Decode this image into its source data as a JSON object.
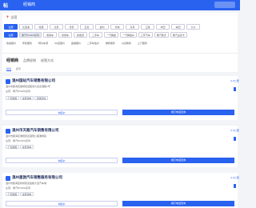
{
  "header": {
    "logo": "帖",
    "title": "经销商",
    "action": ""
  },
  "location": {
    "label": "全国"
  },
  "filters": {
    "row1": [
      "全部",
      "比亚迪",
      "哈弗",
      "北京",
      "长安",
      "五菱",
      "吉利",
      "长城",
      "东风",
      "江淮",
      "丰田",
      "本田",
      "大众",
      "三菱"
    ],
    "row2": [
      "全部",
      "重汽HOWO系列",
      "乘用车",
      "商用车",
      "新能源",
      "二手车",
      "一汽解放",
      "一汽解放J6",
      "三环汽车",
      "重汽豪沃",
      "重汽汕德卡"
    ],
    "row3": [
      "快速报价",
      "年检服务",
      "特价车源",
      "4S店报价",
      "金融报价",
      "二手车估价",
      "维修保养",
      "以旧换新",
      "上门服务"
    ]
  },
  "tabs": [
    {
      "label": "经销商",
      "active": true
    },
    {
      "label": "品牌经销",
      "active": false
    },
    {
      "label": "经营方式",
      "active": false
    }
  ],
  "subtabs": [
    {
      "label": "综合",
      "active": true
    },
    {
      "label": "距离",
      "active": false
    }
  ],
  "cards": [
    {
      "name": "温州国站汽车销售有限公司",
      "address": "温州市瓯海区娄桥街道瓯海大道龙港路1号",
      "brands_label": "主营：",
      "brands": "重汽HOWO系列",
      "tags": [
        "厂商授权",
        "在售新车",
        "店铺活动"
      ],
      "distance": "4.2公里",
      "left_button": "询底价",
      "right_button": "拨打电话咨询"
    },
    {
      "name": "温州市天路汽车销售有限公司",
      "address": "温州市瓯海区潘桥街道温瑞公路潘桥段",
      "brands_label": "主营：",
      "brands": "重汽HOWO系列",
      "tags": [
        "厂商授权",
        "在售新车"
      ],
      "distance": "4.2公里",
      "left_button": "询底价",
      "right_button": "拨打电话咨询"
    },
    {
      "name": "温州星驰汽车销售服务有限公司",
      "address": "温州市瓯海区新桥街道金蟾大道汽车城",
      "brands_label": "主营：",
      "brands": "重汽HOWO系列",
      "tags": [
        "厂商授权",
        "在售新车"
      ],
      "distance": "4.2公里",
      "left_button": "询底价",
      "right_button": "拨打电话咨询"
    }
  ],
  "colors": {
    "accent": "#2a62f0",
    "background": "#f3f4f7",
    "card": "#ffffff"
  }
}
